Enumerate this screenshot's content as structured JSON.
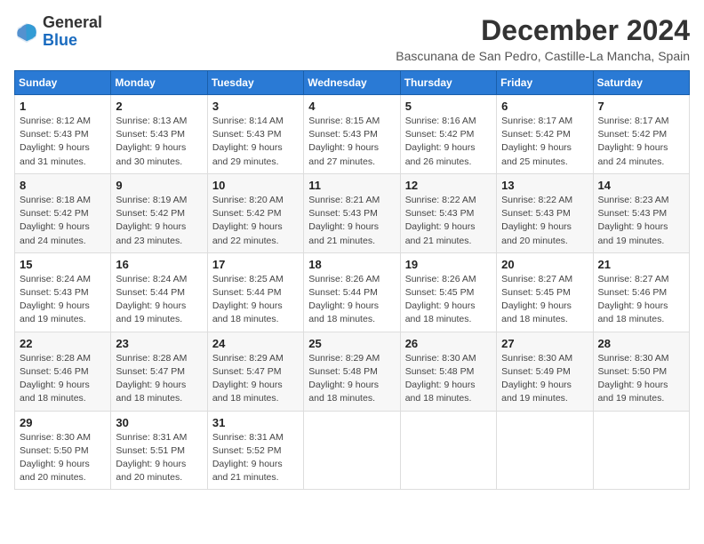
{
  "logo": {
    "general": "General",
    "blue": "Blue"
  },
  "title": "December 2024",
  "subtitle": "Bascunana de San Pedro, Castille-La Mancha, Spain",
  "days_header": [
    "Sunday",
    "Monday",
    "Tuesday",
    "Wednesday",
    "Thursday",
    "Friday",
    "Saturday"
  ],
  "weeks": [
    [
      {
        "num": "1",
        "sunrise": "8:12 AM",
        "sunset": "5:43 PM",
        "daylight": "9 hours and 31 minutes."
      },
      {
        "num": "2",
        "sunrise": "8:13 AM",
        "sunset": "5:43 PM",
        "daylight": "9 hours and 30 minutes."
      },
      {
        "num": "3",
        "sunrise": "8:14 AM",
        "sunset": "5:43 PM",
        "daylight": "9 hours and 29 minutes."
      },
      {
        "num": "4",
        "sunrise": "8:15 AM",
        "sunset": "5:43 PM",
        "daylight": "9 hours and 27 minutes."
      },
      {
        "num": "5",
        "sunrise": "8:16 AM",
        "sunset": "5:42 PM",
        "daylight": "9 hours and 26 minutes."
      },
      {
        "num": "6",
        "sunrise": "8:17 AM",
        "sunset": "5:42 PM",
        "daylight": "9 hours and 25 minutes."
      },
      {
        "num": "7",
        "sunrise": "8:17 AM",
        "sunset": "5:42 PM",
        "daylight": "9 hours and 24 minutes."
      }
    ],
    [
      {
        "num": "8",
        "sunrise": "8:18 AM",
        "sunset": "5:42 PM",
        "daylight": "9 hours and 24 minutes."
      },
      {
        "num": "9",
        "sunrise": "8:19 AM",
        "sunset": "5:42 PM",
        "daylight": "9 hours and 23 minutes."
      },
      {
        "num": "10",
        "sunrise": "8:20 AM",
        "sunset": "5:42 PM",
        "daylight": "9 hours and 22 minutes."
      },
      {
        "num": "11",
        "sunrise": "8:21 AM",
        "sunset": "5:43 PM",
        "daylight": "9 hours and 21 minutes."
      },
      {
        "num": "12",
        "sunrise": "8:22 AM",
        "sunset": "5:43 PM",
        "daylight": "9 hours and 21 minutes."
      },
      {
        "num": "13",
        "sunrise": "8:22 AM",
        "sunset": "5:43 PM",
        "daylight": "9 hours and 20 minutes."
      },
      {
        "num": "14",
        "sunrise": "8:23 AM",
        "sunset": "5:43 PM",
        "daylight": "9 hours and 19 minutes."
      }
    ],
    [
      {
        "num": "15",
        "sunrise": "8:24 AM",
        "sunset": "5:43 PM",
        "daylight": "9 hours and 19 minutes."
      },
      {
        "num": "16",
        "sunrise": "8:24 AM",
        "sunset": "5:44 PM",
        "daylight": "9 hours and 19 minutes."
      },
      {
        "num": "17",
        "sunrise": "8:25 AM",
        "sunset": "5:44 PM",
        "daylight": "9 hours and 18 minutes."
      },
      {
        "num": "18",
        "sunrise": "8:26 AM",
        "sunset": "5:44 PM",
        "daylight": "9 hours and 18 minutes."
      },
      {
        "num": "19",
        "sunrise": "8:26 AM",
        "sunset": "5:45 PM",
        "daylight": "9 hours and 18 minutes."
      },
      {
        "num": "20",
        "sunrise": "8:27 AM",
        "sunset": "5:45 PM",
        "daylight": "9 hours and 18 minutes."
      },
      {
        "num": "21",
        "sunrise": "8:27 AM",
        "sunset": "5:46 PM",
        "daylight": "9 hours and 18 minutes."
      }
    ],
    [
      {
        "num": "22",
        "sunrise": "8:28 AM",
        "sunset": "5:46 PM",
        "daylight": "9 hours and 18 minutes."
      },
      {
        "num": "23",
        "sunrise": "8:28 AM",
        "sunset": "5:47 PM",
        "daylight": "9 hours and 18 minutes."
      },
      {
        "num": "24",
        "sunrise": "8:29 AM",
        "sunset": "5:47 PM",
        "daylight": "9 hours and 18 minutes."
      },
      {
        "num": "25",
        "sunrise": "8:29 AM",
        "sunset": "5:48 PM",
        "daylight": "9 hours and 18 minutes."
      },
      {
        "num": "26",
        "sunrise": "8:30 AM",
        "sunset": "5:48 PM",
        "daylight": "9 hours and 18 minutes."
      },
      {
        "num": "27",
        "sunrise": "8:30 AM",
        "sunset": "5:49 PM",
        "daylight": "9 hours and 19 minutes."
      },
      {
        "num": "28",
        "sunrise": "8:30 AM",
        "sunset": "5:50 PM",
        "daylight": "9 hours and 19 minutes."
      }
    ],
    [
      {
        "num": "29",
        "sunrise": "8:30 AM",
        "sunset": "5:50 PM",
        "daylight": "9 hours and 20 minutes."
      },
      {
        "num": "30",
        "sunrise": "8:31 AM",
        "sunset": "5:51 PM",
        "daylight": "9 hours and 20 minutes."
      },
      {
        "num": "31",
        "sunrise": "8:31 AM",
        "sunset": "5:52 PM",
        "daylight": "9 hours and 21 minutes."
      },
      null,
      null,
      null,
      null
    ]
  ]
}
